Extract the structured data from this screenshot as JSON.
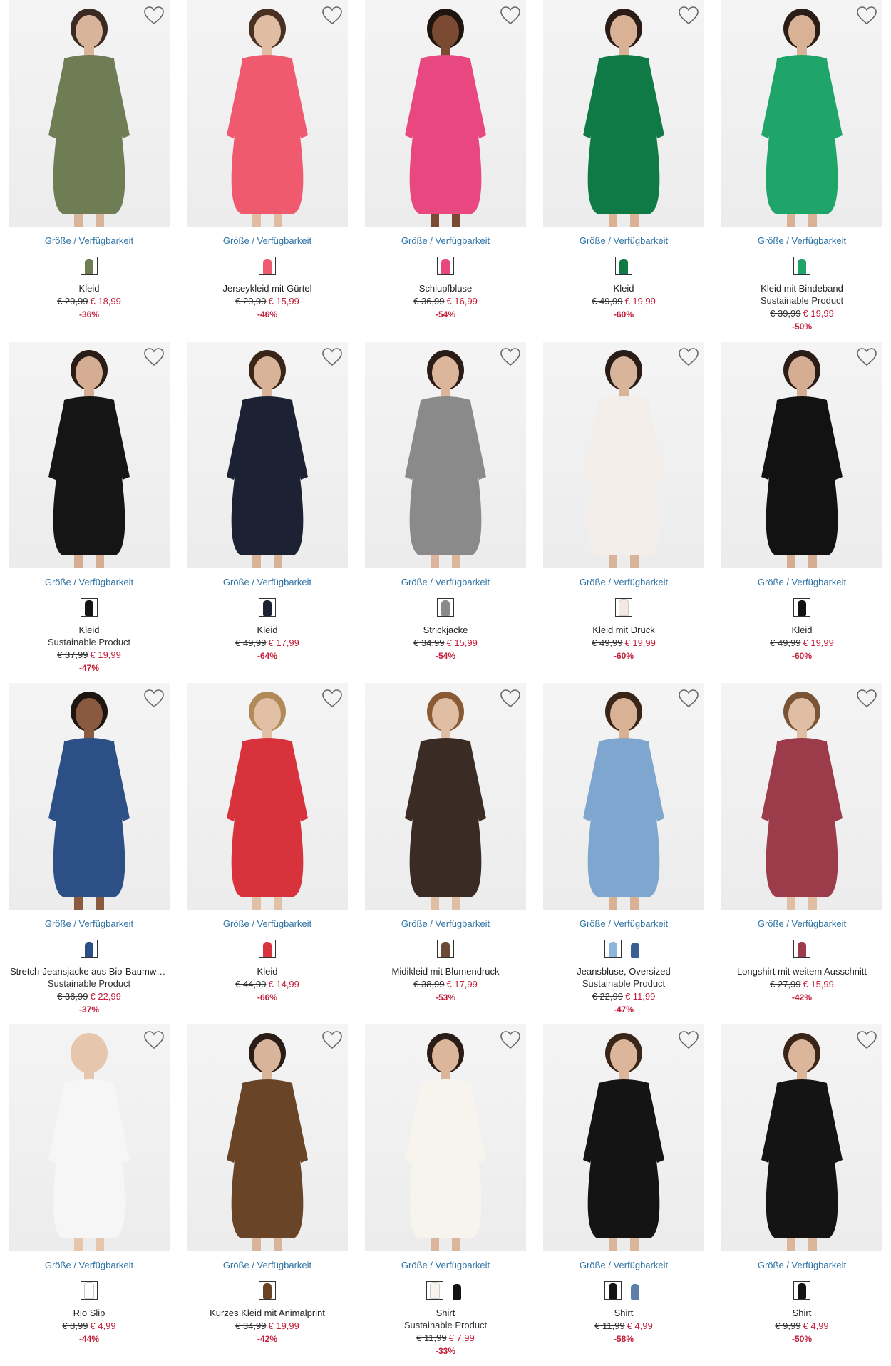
{
  "products": [
    {
      "size_link": "Größe / Verfügbarkeit",
      "name": "Kleid",
      "sub": "",
      "old_price": "€ 29,99",
      "new_price": "€ 18,99",
      "discount": "-36%",
      "color": "#6f7d55",
      "swatches": [
        "#6f7d55"
      ],
      "skin": "#d8b49a",
      "hair": "#3b2a22"
    },
    {
      "size_link": "Größe / Verfügbarkeit",
      "name": "Jerseykleid mit Gürtel",
      "sub": "",
      "old_price": "€ 29,99",
      "new_price": "€ 15,99",
      "discount": "-46%",
      "color": "#f05a6e",
      "swatches": [
        "#f05a6e"
      ],
      "skin": "#e0bca2",
      "hair": "#4a3022"
    },
    {
      "size_link": "Größe / Verfügbarkeit",
      "name": "Schlupfbluse",
      "sub": "",
      "old_price": "€ 36,99",
      "new_price": "€ 16,99",
      "discount": "-54%",
      "color": "#e8477f",
      "swatches": [
        "#e8477f"
      ],
      "skin": "#7a4a32",
      "hair": "#1e1410"
    },
    {
      "size_link": "Größe / Verfügbarkeit",
      "name": "Kleid",
      "sub": "",
      "old_price": "€ 49,99",
      "new_price": "€ 19,99",
      "discount": "-60%",
      "color": "#0f7a45",
      "swatches": [
        "#0f7a45"
      ],
      "skin": "#d9b295",
      "hair": "#2a1c16"
    },
    {
      "size_link": "Größe / Verfügbarkeit",
      "name": "Kleid mit Bindeband",
      "sub": "Sustainable Product",
      "old_price": "€ 39,99",
      "new_price": "€ 19,99",
      "discount": "-50%",
      "color": "#1fa56a",
      "swatches": [
        "#1fa56a"
      ],
      "skin": "#d9b295",
      "hair": "#2a1c16"
    },
    {
      "size_link": "Größe / Verfügbarkeit",
      "name": "Kleid",
      "sub": "Sustainable Product",
      "old_price": "€ 37,99",
      "new_price": "€ 19,99",
      "discount": "-47%",
      "color": "#151515",
      "swatches": [
        "#151515"
      ],
      "skin": "#d4ad93",
      "hair": "#2a1c16"
    },
    {
      "size_link": "Größe / Verfügbarkeit",
      "name": "Kleid",
      "sub": "",
      "old_price": "€ 49,99",
      "new_price": "€ 17,99",
      "discount": "-64%",
      "color": "#1c2233",
      "swatches": [
        "#1c2233"
      ],
      "skin": "#d8b398",
      "hair": "#3a2618"
    },
    {
      "size_link": "Größe / Verfügbarkeit",
      "name": "Strickjacke",
      "sub": "",
      "old_price": "€ 34,99",
      "new_price": "€ 15,99",
      "discount": "-54%",
      "color": "#8a8a8a",
      "swatches": [
        "#8a8a8a"
      ],
      "skin": "#dcb69a",
      "hair": "#2a1c16"
    },
    {
      "size_link": "Größe / Verfügbarkeit",
      "name": "Kleid mit Druck",
      "sub": "",
      "old_price": "€ 49,99",
      "new_price": "€ 19,99",
      "discount": "-60%",
      "color": "#f3eee9",
      "swatches": [
        "#f3e8e4"
      ],
      "skin": "#d8b49a",
      "hair": "#2a1c16"
    },
    {
      "size_link": "Größe / Verfügbarkeit",
      "name": "Kleid",
      "sub": "",
      "old_price": "€ 49,99",
      "new_price": "€ 19,99",
      "discount": "-60%",
      "color": "#121212",
      "swatches": [
        "#121212"
      ],
      "skin": "#d4ad93",
      "hair": "#2a1c16"
    },
    {
      "size_link": "Größe / Verfügbarkeit",
      "name": "Stretch-Jeansjacke aus Bio-Baumwolle",
      "sub": "Sustainable Product",
      "old_price": "€ 36,99",
      "new_price": "€ 22,99",
      "discount": "-37%",
      "color": "#2c4f86",
      "swatches": [
        "#2c4f86"
      ],
      "skin": "#8a5a40",
      "hair": "#1e1410"
    },
    {
      "size_link": "Größe / Verfügbarkeit",
      "name": "Kleid",
      "sub": "",
      "old_price": "€ 44,99",
      "new_price": "€ 14,99",
      "discount": "-66%",
      "color": "#d8323c",
      "swatches": [
        "#d8323c"
      ],
      "skin": "#e2c0a6",
      "hair": "#b08a58"
    },
    {
      "size_link": "Größe / Verfügbarkeit",
      "name": "Midikleid mit Blumendruck",
      "sub": "",
      "old_price": "€ 38,99",
      "new_price": "€ 17,99",
      "discount": "-53%",
      "color": "#3a2c24",
      "swatches": [
        "#6b4a38"
      ],
      "skin": "#e0bea4",
      "hair": "#8a5a34"
    },
    {
      "size_link": "Größe / Verfügbarkeit",
      "name": "Jeansbluse, Oversized",
      "sub": "Sustainable Product",
      "old_price": "€ 22,99",
      "new_price": "€ 11,99",
      "discount": "-47%",
      "color": "#7fa6cf",
      "swatches": [
        "#8fb5dd",
        "#3b5e96"
      ],
      "skin": "#d9b295",
      "hair": "#3a2618"
    },
    {
      "size_link": "Größe / Verfügbarkeit",
      "name": "Longshirt mit weitem Ausschnitt",
      "sub": "",
      "old_price": "€ 27,99",
      "new_price": "€ 15,99",
      "discount": "-42%",
      "color": "#9c3c4a",
      "swatches": [
        "#9c3c4a"
      ],
      "skin": "#e0bea4",
      "hair": "#7a5434"
    },
    {
      "size_link": "Größe / Verfügbarkeit",
      "name": "Rio Slip",
      "sub": "",
      "old_price": "€ 8,99",
      "new_price": "€ 4,99",
      "discount": "-44%",
      "color": "#f6f6f6",
      "swatches": [
        "#ffffff"
      ],
      "skin": "#e6c7ae",
      "hair": "#e6c7ae"
    },
    {
      "size_link": "Größe / Verfügbarkeit",
      "name": "Kurzes Kleid mit Animalprint",
      "sub": "",
      "old_price": "€ 34,99",
      "new_price": "€ 19,99",
      "discount": "-42%",
      "color": "#6a4426",
      "swatches": [
        "#6a4426"
      ],
      "skin": "#d8b49a",
      "hair": "#2a1c16"
    },
    {
      "size_link": "Größe / Verfügbarkeit",
      "name": "Shirt",
      "sub": "Sustainable Product",
      "old_price": "€ 11,99",
      "new_price": "€ 7,99",
      "discount": "-33%",
      "color": "#f7f4ee",
      "swatches": [
        "#f7f4ee",
        "#111111"
      ],
      "skin": "#dcb69a",
      "hair": "#2a1c16"
    },
    {
      "size_link": "Größe / Verfügbarkeit",
      "name": "Shirt",
      "sub": "",
      "old_price": "€ 11,99",
      "new_price": "€ 4,99",
      "discount": "-58%",
      "color": "#141414",
      "swatches": [
        "#141414",
        "#5d7ea8"
      ],
      "skin": "#dcb69a",
      "hair": "#3a2618"
    },
    {
      "size_link": "Größe / Verfügbarkeit",
      "name": "Shirt",
      "sub": "",
      "old_price": "€ 9,99",
      "new_price": "€ 4,99",
      "discount": "-50%",
      "color": "#141414",
      "swatches": [
        "#141414"
      ],
      "skin": "#dcb69a",
      "hair": "#3a2618"
    }
  ]
}
